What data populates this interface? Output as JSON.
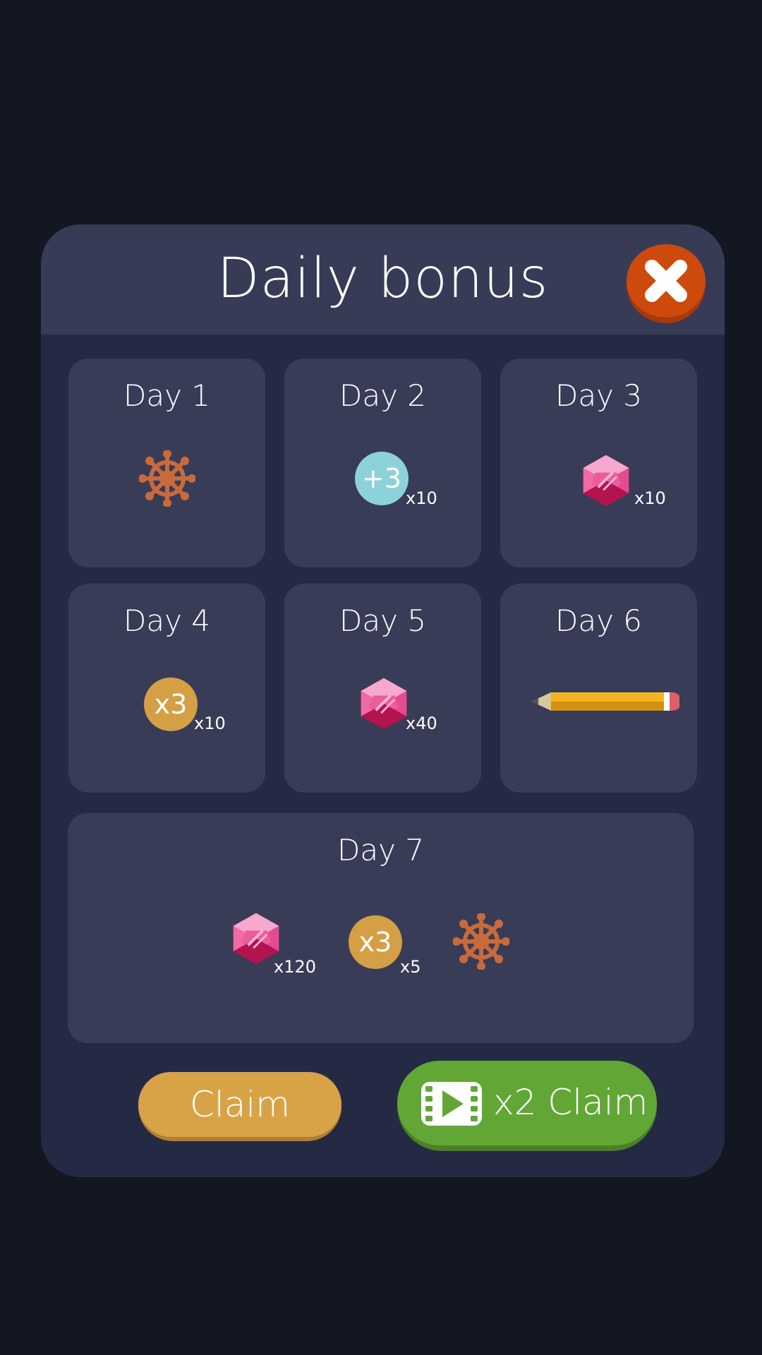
{
  "dialog": {
    "title": "Daily bonus",
    "close_icon": "close-x-icon"
  },
  "days": [
    {
      "label": "Day 1",
      "rewards": [
        {
          "icon": "ship-wheel-icon",
          "quantity": ""
        }
      ]
    },
    {
      "label": "Day 2",
      "rewards": [
        {
          "icon": "plus-three-coin-icon",
          "text": "+3",
          "quantity": "x10"
        }
      ]
    },
    {
      "label": "Day 3",
      "rewards": [
        {
          "icon": "pink-gem-icon",
          "quantity": "x10"
        }
      ]
    },
    {
      "label": "Day 4",
      "rewards": [
        {
          "icon": "x3-coin-icon",
          "text": "x3",
          "quantity": "x10"
        }
      ]
    },
    {
      "label": "Day 5",
      "rewards": [
        {
          "icon": "pink-gem-icon",
          "quantity": "x40"
        }
      ]
    },
    {
      "label": "Day 6",
      "rewards": [
        {
          "icon": "pencil-icon",
          "quantity": ""
        }
      ]
    },
    {
      "label": "Day 7",
      "rewards": [
        {
          "icon": "pink-gem-icon",
          "quantity": "x120"
        },
        {
          "icon": "x3-coin-icon",
          "text": "x3",
          "quantity": "x5"
        },
        {
          "icon": "ship-wheel-icon",
          "quantity": ""
        }
      ]
    }
  ],
  "buttons": {
    "claim_label": "Claim",
    "x2_claim_label": "x2 Claim",
    "x2_icon": "video-icon"
  },
  "colors": {
    "background": "#131722",
    "panel": "#242a44",
    "card": "#383c57",
    "close": "#cd4a0c",
    "claim": "#d8a347",
    "x2_claim": "#62a736",
    "gem": "#e2418a",
    "wheel": "#c86a3c",
    "coin_blue": "#8ed2d9",
    "coin_gold": "#d59f45"
  }
}
